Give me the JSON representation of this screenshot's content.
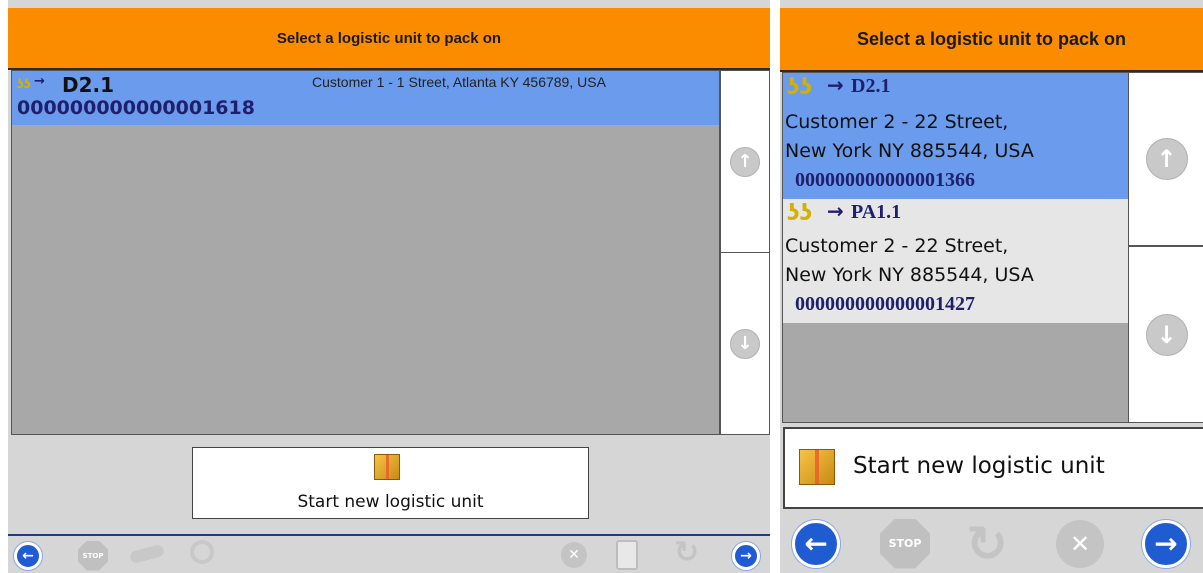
{
  "left": {
    "header_title": "Select a logistic unit to pack on",
    "items": [
      {
        "unit": "D2.1",
        "address": "Customer 1 - 1 Street, Atlanta KY  456789, USA",
        "code": "000000000000001618"
      }
    ],
    "new_unit_label": "Start new logistic unit"
  },
  "right": {
    "header_title": "Select a logistic unit to pack on",
    "items": [
      {
        "unit": "D2.1",
        "address_line1": "Customer 2 - 22 Street,",
        "address_line2": "New York NY  885544, USA",
        "code": "000000000000001366"
      },
      {
        "unit": "PA1.1",
        "address_line1": "Customer 2 - 22 Street,",
        "address_line2": "New York NY  885544, USA",
        "code": "000000000000001427"
      }
    ],
    "new_unit_label": "Start new logistic unit"
  },
  "glyphs": {
    "arrow_right": "→",
    "up": "↑",
    "down": "↓",
    "back": "←",
    "forward": "→",
    "stop": "STOP",
    "close": "✕",
    "refresh": "↻"
  },
  "colors": {
    "header": "#fb8c00",
    "selected_row": "#6b9bec",
    "code_text": "#1f1f6e",
    "nav_blue": "#1f5bd1"
  }
}
